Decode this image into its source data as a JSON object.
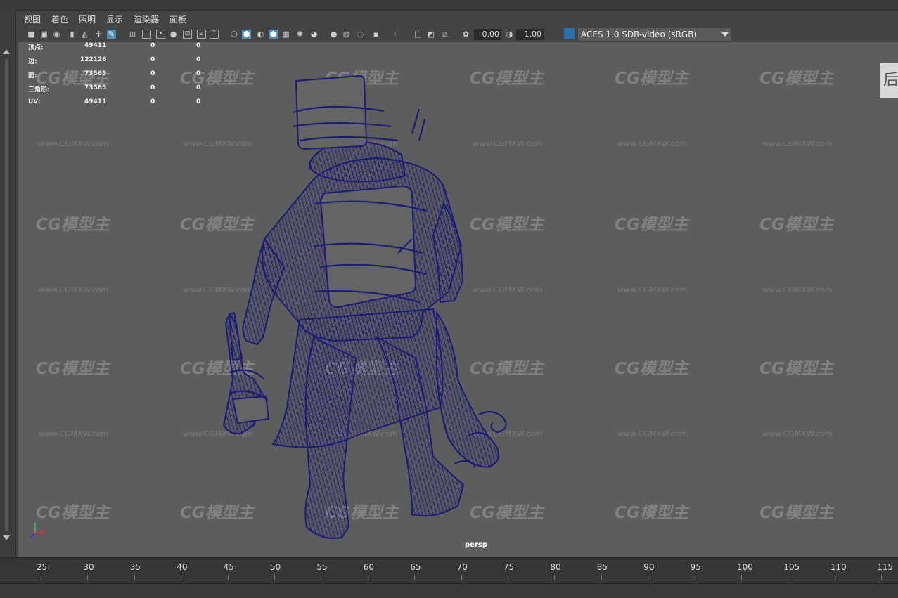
{
  "menu": [
    "视图",
    "着色",
    "照明",
    "显示",
    "渲染器",
    "面板"
  ],
  "toolbar": {
    "exposure": "0.00",
    "gamma": "1.00",
    "color_space": "ACES 1.0 SDR-video (sRGB)"
  },
  "hud": {
    "rows": [
      {
        "label": "顶点:",
        "v1": "49411",
        "v2": "0",
        "v3": "0"
      },
      {
        "label": "边:",
        "v1": "122126",
        "v2": "0",
        "v3": "0"
      },
      {
        "label": "面:",
        "v1": "73565",
        "v2": "0",
        "v3": "0"
      },
      {
        "label": "三角形:",
        "v1": "73565",
        "v2": "0",
        "v3": "0"
      },
      {
        "label": "UV:",
        "v1": "49411",
        "v2": "0",
        "v3": "0"
      }
    ]
  },
  "viewport": {
    "camera_label": "persp",
    "viewcube_label": "后",
    "watermark_logo": "CG模型主",
    "watermark_url": "www.CGMXW.com"
  },
  "timeline": {
    "ticks": [
      "25",
      "30",
      "35",
      "40",
      "45",
      "50",
      "55",
      "60",
      "65",
      "70",
      "75",
      "80",
      "85",
      "90",
      "95",
      "100",
      "105",
      "110",
      "115"
    ]
  },
  "colors": {
    "viewport_bg": "#5d5d5d",
    "wireframe": "#1c1c78",
    "accent": "#4f8fb6"
  }
}
